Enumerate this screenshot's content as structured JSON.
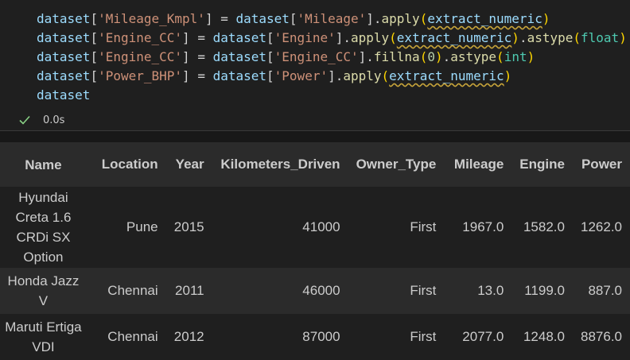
{
  "code": {
    "lines": [
      [
        [
          "var",
          "dataset"
        ],
        [
          "op",
          "["
        ],
        [
          "str",
          "'Mileage_Kmpl'"
        ],
        [
          "op",
          "] = "
        ],
        [
          "var",
          "dataset"
        ],
        [
          "op",
          "["
        ],
        [
          "str",
          "'Mileage'"
        ],
        [
          "op",
          "]."
        ],
        [
          "fn",
          "apply"
        ],
        [
          "p1",
          "("
        ],
        [
          "var squig",
          "extract_numeric"
        ],
        [
          "p1",
          ")"
        ]
      ],
      [
        [
          "var",
          "dataset"
        ],
        [
          "op",
          "["
        ],
        [
          "str",
          "'Engine_CC'"
        ],
        [
          "op",
          "] = "
        ],
        [
          "var",
          "dataset"
        ],
        [
          "op",
          "["
        ],
        [
          "str",
          "'Engine'"
        ],
        [
          "op",
          "]."
        ],
        [
          "fn",
          "apply"
        ],
        [
          "p1",
          "("
        ],
        [
          "var squig",
          "extract_numeric"
        ],
        [
          "p1",
          ")"
        ],
        [
          "op",
          "."
        ],
        [
          "fn",
          "astype"
        ],
        [
          "p1",
          "("
        ],
        [
          "bi",
          "float"
        ],
        [
          "p1",
          ")"
        ]
      ],
      [
        [
          "var",
          "dataset"
        ],
        [
          "op",
          "["
        ],
        [
          "str",
          "'Engine_CC'"
        ],
        [
          "op",
          "] = "
        ],
        [
          "var",
          "dataset"
        ],
        [
          "op",
          "["
        ],
        [
          "str",
          "'Engine_CC'"
        ],
        [
          "op",
          "]."
        ],
        [
          "fn",
          "fillna"
        ],
        [
          "p1",
          "("
        ],
        [
          "num",
          "0"
        ],
        [
          "p1",
          ")"
        ],
        [
          "op",
          "."
        ],
        [
          "fn",
          "astype"
        ],
        [
          "p1",
          "("
        ],
        [
          "bi",
          "int"
        ],
        [
          "p1",
          ")"
        ]
      ],
      [
        [
          "var",
          "dataset"
        ],
        [
          "op",
          "["
        ],
        [
          "str",
          "'Power_BHP'"
        ],
        [
          "op",
          "] = "
        ],
        [
          "var",
          "dataset"
        ],
        [
          "op",
          "["
        ],
        [
          "str",
          "'Power'"
        ],
        [
          "op",
          "]."
        ],
        [
          "fn",
          "apply"
        ],
        [
          "p1",
          "("
        ],
        [
          "var squig",
          "extract_numeric"
        ],
        [
          "p1",
          ")"
        ]
      ],
      [
        [
          "var",
          "dataset"
        ]
      ]
    ]
  },
  "status": {
    "icon": "check-icon",
    "duration": "0.0s",
    "color": "#89d185"
  },
  "table": {
    "columns": [
      "Name",
      "Location",
      "Year",
      "Kilometers_Driven",
      "Owner_Type",
      "Mileage",
      "Engine",
      "Power"
    ],
    "rows": [
      [
        "Hyundai Creta 1.6 CRDi SX Option",
        "Pune",
        "2015",
        "41000",
        "First",
        "1967.0",
        "1582.0",
        "1262.0"
      ],
      [
        "Honda Jazz V",
        "Chennai",
        "2011",
        "46000",
        "First",
        "13.0",
        "1199.0",
        "887.0"
      ],
      [
        "Maruti Ertiga VDI",
        "Chennai",
        "2012",
        "87000",
        "First",
        "2077.0",
        "1248.0",
        "8876.0"
      ]
    ]
  }
}
